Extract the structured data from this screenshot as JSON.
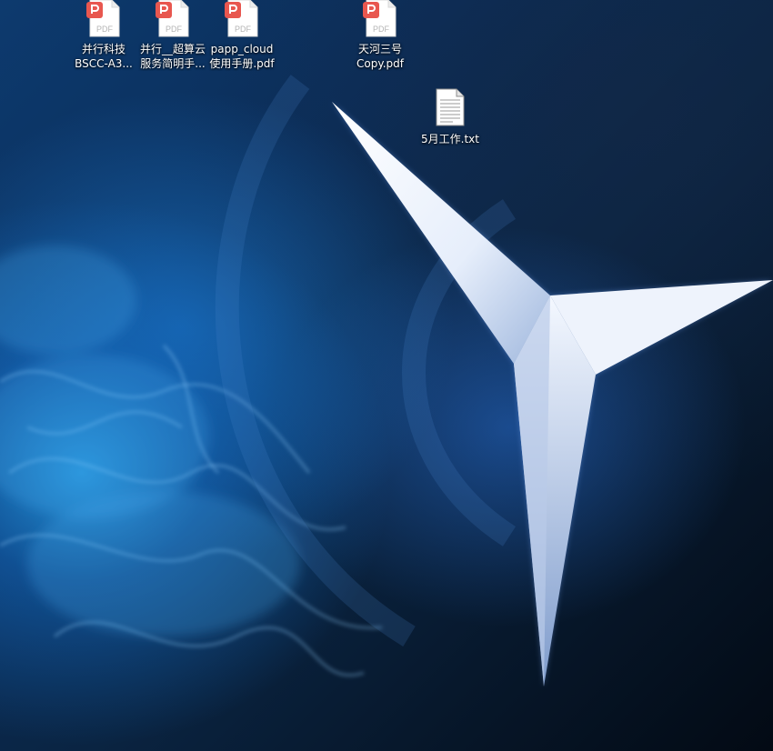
{
  "desktop": {
    "icons": [
      {
        "type": "pdf",
        "line1": "并行科技",
        "line2": "BSCC-A3...",
        "badge": "PDF"
      },
      {
        "type": "pdf",
        "line1": "并行__超算云",
        "line2": "服务简明手...",
        "badge": "PDF"
      },
      {
        "type": "pdf",
        "line1": "papp_cloud",
        "line2": "使用手册.pdf",
        "badge": "PDF"
      },
      {
        "type": "pdf",
        "line1": "天河三号",
        "line2": "Copy.pdf",
        "badge": "PDF"
      },
      {
        "type": "txt",
        "line1": "5月工作.txt",
        "line2": ""
      }
    ]
  },
  "colors": {
    "pdf_accent": "#e8574f",
    "pdf_page": "#ffffff",
    "label_text": "#ffffff"
  }
}
